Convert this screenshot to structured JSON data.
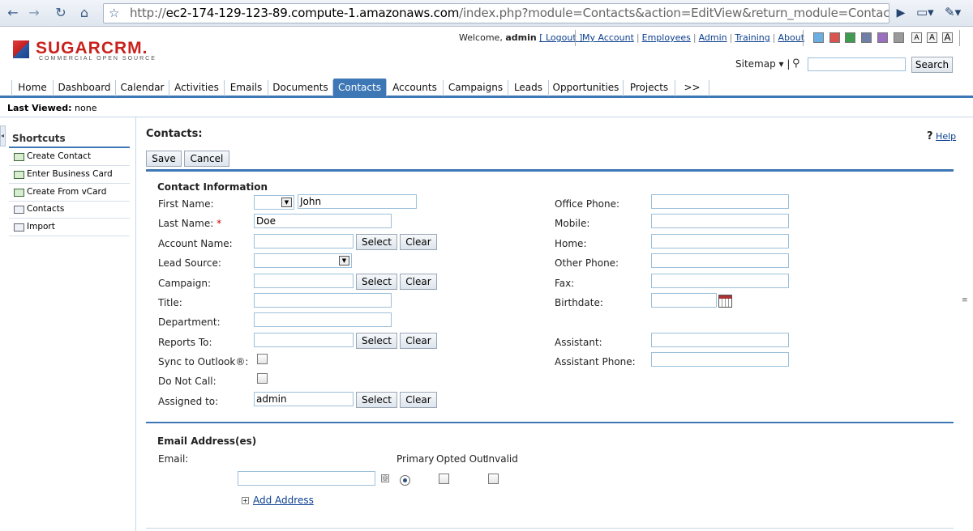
{
  "browser": {
    "url_prefix": "http://",
    "url_host": "ec2-174-129-123-89.compute-1.amazonaws.com",
    "url_path": "/index.php?module=Contacts&action=EditView&return_module=Contacts&return_action=inde"
  },
  "header": {
    "logo_text": "SUGARCRM.",
    "logo_sub": "COMMERCIAL OPEN SOURCE",
    "welcome_prefix": "Welcome, ",
    "user": "admin",
    "logout": "[ Logout ]",
    "links": [
      "My Account",
      "Employees",
      "Admin",
      "Training",
      "About"
    ],
    "swatch_colors": [
      "#6aaee4",
      "#d9534f",
      "#3f9b4f",
      "#6f7fa8",
      "#9a6fbf",
      "#9a9a9a"
    ],
    "font_buttons": [
      "A",
      "A",
      "A"
    ],
    "sitemap": "Sitemap ▾ |",
    "search_button": "Search",
    "search_value": ""
  },
  "tabs": [
    "Home",
    "Dashboard",
    "Calendar",
    "Activities",
    "Emails",
    "Documents",
    "Contacts",
    "Accounts",
    "Campaigns",
    "Leads",
    "Opportunities",
    "Projects",
    ">>"
  ],
  "active_tab": "Contacts",
  "last_viewed": {
    "label": "Last Viewed:",
    "value": "none"
  },
  "sidebar": {
    "title": "Shortcuts",
    "items": [
      "Create Contact",
      "Enter Business Card",
      "Create From vCard",
      "Contacts",
      "Import"
    ]
  },
  "main": {
    "title": "Contacts:",
    "help": "Help",
    "save": "Save",
    "cancel": "Cancel",
    "panel_title": "Contact Information",
    "select": "Select",
    "clear": "Clear",
    "left_fields": {
      "first_name": {
        "label": "First Name:",
        "salutation": "",
        "value": "John"
      },
      "last_name": {
        "label": "Last Name:",
        "required": "*",
        "value": "Doe"
      },
      "account_name": {
        "label": "Account Name:",
        "value": ""
      },
      "lead_source": {
        "label": "Lead Source:",
        "value": ""
      },
      "campaign": {
        "label": "Campaign:",
        "value": ""
      },
      "title": {
        "label": "Title:",
        "value": ""
      },
      "department": {
        "label": "Department:",
        "value": ""
      },
      "reports_to": {
        "label": "Reports To:",
        "value": ""
      },
      "sync_outlook": {
        "label": "Sync to Outlook®:",
        "checked": false
      },
      "do_not_call": {
        "label": "Do Not Call:",
        "checked": false
      },
      "assigned_to": {
        "label": "Assigned to:",
        "value": "admin"
      }
    },
    "right_fields": {
      "office_phone": {
        "label": "Office Phone:",
        "value": ""
      },
      "mobile": {
        "label": "Mobile:",
        "value": ""
      },
      "home": {
        "label": "Home:",
        "value": ""
      },
      "other_phone": {
        "label": "Other Phone:",
        "value": ""
      },
      "fax": {
        "label": "Fax:",
        "value": ""
      },
      "birthdate": {
        "label": "Birthdate:",
        "value": ""
      },
      "assistant": {
        "label": "Assistant:",
        "value": ""
      },
      "assistant_phone": {
        "label": "Assistant Phone:",
        "value": ""
      }
    },
    "email": {
      "section_title": "Email Address(es)",
      "label": "Email:",
      "col_primary": "Primary",
      "col_opted_out": "Opted Out",
      "col_invalid": "Invalid",
      "value": "",
      "primary": true,
      "opted_out": false,
      "invalid": false,
      "add_address": "Add Address"
    }
  }
}
